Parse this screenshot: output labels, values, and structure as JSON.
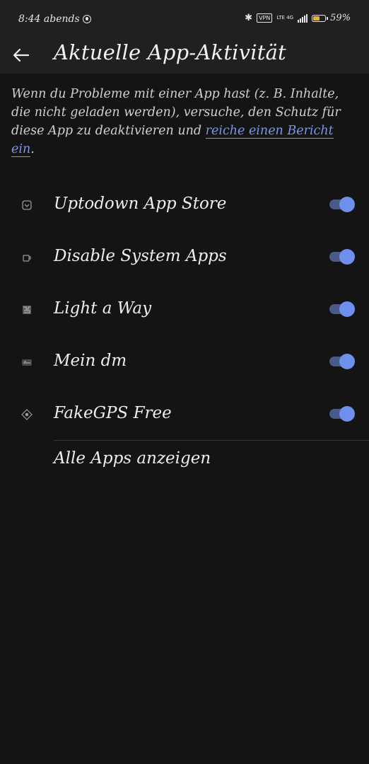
{
  "status_bar": {
    "time": "8:44 abends",
    "vpn": "VPN",
    "network": "LTE 4G",
    "battery_percent": "59%",
    "battery_level": 0.59,
    "icons": [
      "do-not-disturb-icon",
      "bluetooth-icon",
      "vpn-icon",
      "signal-icon",
      "battery-icon"
    ]
  },
  "header": {
    "title": "Aktuelle App-Aktivität",
    "back_icon": "arrow-left-icon"
  },
  "intro": {
    "text": "Wenn du Probleme mit einer App hast (z. B. Inhalte, die nicht geladen werden), versuche, den Schutz für diese App zu deaktivieren und ",
    "link": "reiche einen Bericht ein",
    "suffix": "."
  },
  "apps": [
    {
      "name": "Uptodown App Store",
      "icon": "uptodown-icon",
      "enabled": true
    },
    {
      "name": "Disable System Apps",
      "icon": "disable-system-apps-icon",
      "enabled": true
    },
    {
      "name": "Light a Way",
      "icon": "light-a-way-icon",
      "enabled": true
    },
    {
      "name": "Mein dm",
      "icon": "mein-dm-icon",
      "enabled": true
    },
    {
      "name": "FakeGPS Free",
      "icon": "fakegps-icon",
      "enabled": true
    }
  ],
  "show_all_label": "Alle Apps anzeigen",
  "colors": {
    "background": "#141414",
    "bar": "#202020",
    "accent": "#6f8fec",
    "link": "#7b95ea"
  }
}
